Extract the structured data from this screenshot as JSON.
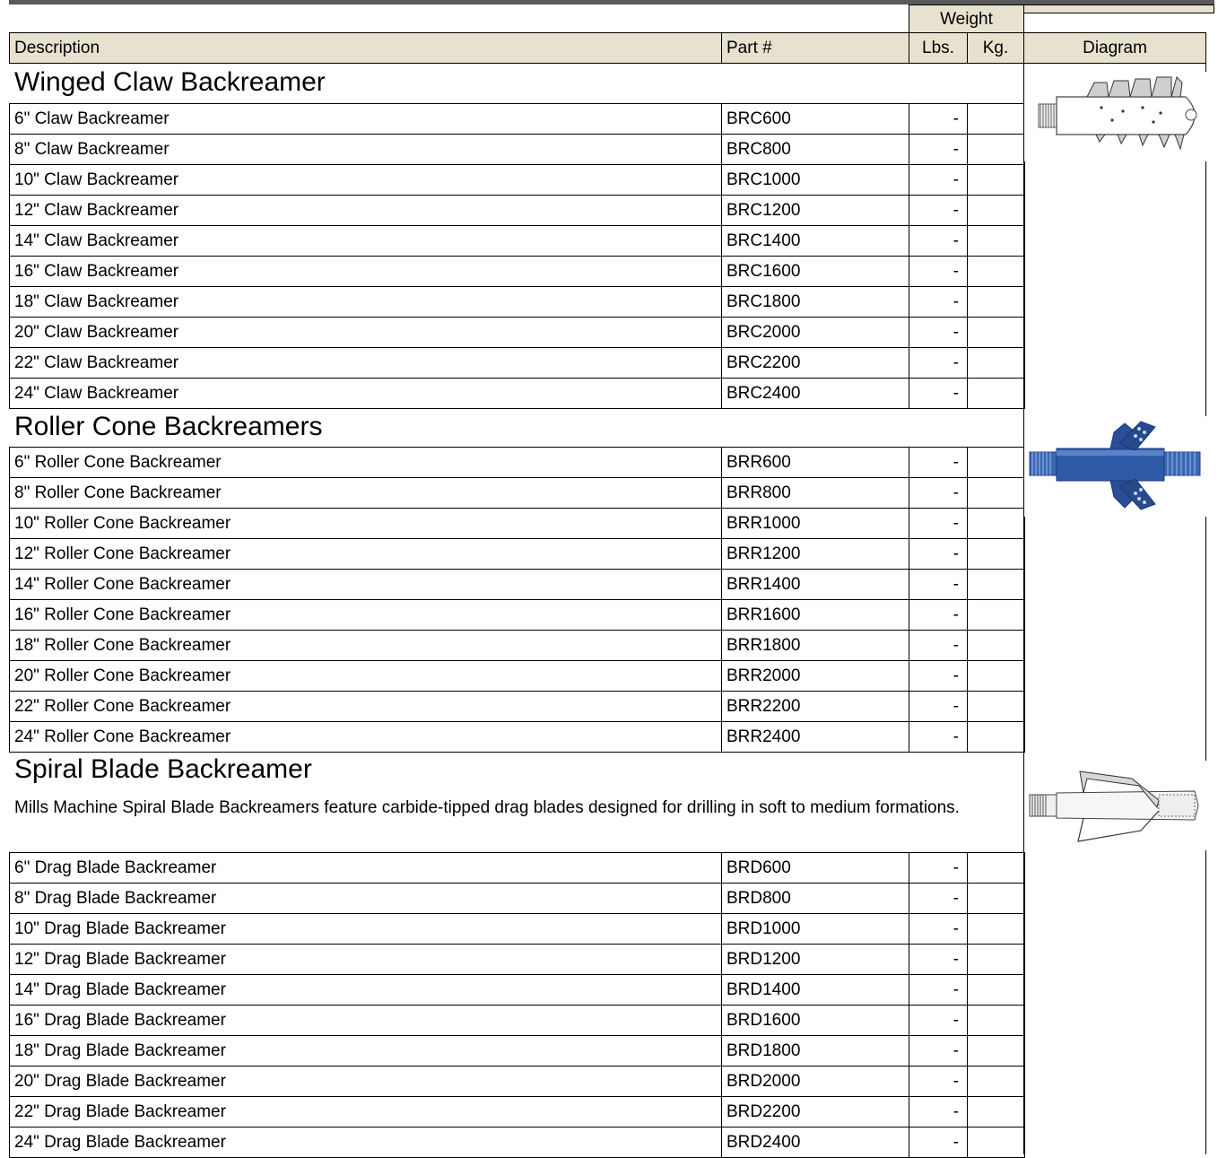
{
  "header": {
    "weight_label": "Weight",
    "description_label": "Description",
    "part_label": "Part #",
    "lbs_label": "Lbs.",
    "kg_label": "Kg.",
    "diagram_label": "Diagram"
  },
  "sections": [
    {
      "title": "Winged Claw Backreamer",
      "description": "",
      "rows": [
        {
          "description": "6\" Claw Backreamer",
          "part": "BRC600",
          "lbs": "-",
          "kg": ""
        },
        {
          "description": "8\" Claw Backreamer",
          "part": "BRC800",
          "lbs": "-",
          "kg": ""
        },
        {
          "description": "10\" Claw Backreamer",
          "part": "BRC1000",
          "lbs": "-",
          "kg": ""
        },
        {
          "description": "12\" Claw Backreamer",
          "part": "BRC1200",
          "lbs": "-",
          "kg": ""
        },
        {
          "description": "14\" Claw Backreamer",
          "part": "BRC1400",
          "lbs": "-",
          "kg": ""
        },
        {
          "description": "16\" Claw Backreamer",
          "part": "BRC1600",
          "lbs": "-",
          "kg": ""
        },
        {
          "description": "18\" Claw Backreamer",
          "part": "BRC1800",
          "lbs": "-",
          "kg": ""
        },
        {
          "description": "20\" Claw Backreamer",
          "part": "BRC2000",
          "lbs": "-",
          "kg": ""
        },
        {
          "description": "22\" Claw Backreamer",
          "part": "BRC2200",
          "lbs": "-",
          "kg": ""
        },
        {
          "description": "24\" Claw Backreamer",
          "part": "BRC2400",
          "lbs": "-",
          "kg": ""
        }
      ]
    },
    {
      "title": "Roller Cone Backreamers",
      "description": "",
      "rows": [
        {
          "description": "6\" Roller Cone Backreamer",
          "part": "BRR600",
          "lbs": "-",
          "kg": ""
        },
        {
          "description": "8\" Roller Cone Backreamer",
          "part": "BRR800",
          "lbs": "-",
          "kg": ""
        },
        {
          "description": "10\" Roller Cone Backreamer",
          "part": "BRR1000",
          "lbs": "-",
          "kg": ""
        },
        {
          "description": "12\" Roller Cone Backreamer",
          "part": "BRR1200",
          "lbs": "-",
          "kg": ""
        },
        {
          "description": "14\" Roller Cone Backreamer",
          "part": "BRR1400",
          "lbs": "-",
          "kg": ""
        },
        {
          "description": "16\" Roller Cone Backreamer",
          "part": "BRR1600",
          "lbs": "-",
          "kg": ""
        },
        {
          "description": "18\" Roller Cone Backreamer",
          "part": "BRR1800",
          "lbs": "-",
          "kg": ""
        },
        {
          "description": "20\" Roller Cone Backreamer",
          "part": "BRR2000",
          "lbs": "-",
          "kg": ""
        },
        {
          "description": "22\" Roller Cone Backreamer",
          "part": "BRR2200",
          "lbs": "-",
          "kg": ""
        },
        {
          "description": "24\" Roller Cone Backreamer",
          "part": "BRR2400",
          "lbs": "-",
          "kg": ""
        }
      ]
    },
    {
      "title": "Spiral Blade Backreamer",
      "description": "Mills Machine Spiral Blade Backreamers feature carbide-tipped drag blades designed for drilling in soft to medium formations.",
      "rows": [
        {
          "description": "6\" Drag Blade Backreamer",
          "part": "BRD600",
          "lbs": "-",
          "kg": ""
        },
        {
          "description": "8\" Drag Blade Backreamer",
          "part": "BRD800",
          "lbs": "-",
          "kg": ""
        },
        {
          "description": "10\" Drag Blade Backreamer",
          "part": "BRD1000",
          "lbs": "-",
          "kg": ""
        },
        {
          "description": "12\" Drag Blade Backreamer",
          "part": "BRD1200",
          "lbs": "-",
          "kg": ""
        },
        {
          "description": "14\" Drag Blade Backreamer",
          "part": "BRD1400",
          "lbs": "-",
          "kg": ""
        },
        {
          "description": "16\" Drag Blade Backreamer",
          "part": "BRD1600",
          "lbs": "-",
          "kg": ""
        },
        {
          "description": "18\" Drag Blade Backreamer",
          "part": "BRD1800",
          "lbs": "-",
          "kg": ""
        },
        {
          "description": "20\" Drag Blade Backreamer",
          "part": "BRD2000",
          "lbs": "-",
          "kg": ""
        },
        {
          "description": "22\" Drag Blade Backreamer",
          "part": "BRD2200",
          "lbs": "-",
          "kg": ""
        },
        {
          "description": "24\" Drag Blade Backreamer",
          "part": "BRD2400",
          "lbs": "-",
          "kg": ""
        }
      ]
    }
  ],
  "diagrams": [
    {
      "icon": "claw-backreamer-icon",
      "color": "#e8e8e8"
    },
    {
      "icon": "roller-cone-backreamer-icon",
      "color": "#2f5aa8"
    },
    {
      "icon": "spiral-blade-backreamer-icon",
      "color": "#ececec"
    }
  ]
}
